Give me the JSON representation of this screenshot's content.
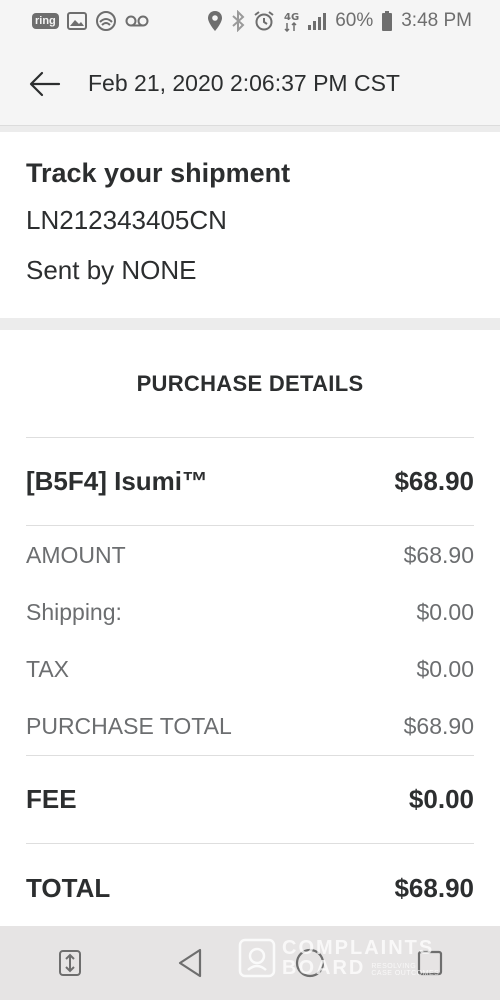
{
  "status_bar": {
    "ring_label": "ring",
    "battery": "60%",
    "time": "3:48 PM",
    "network_label": "4G",
    "icons": [
      "ring-icon",
      "image-icon",
      "allstate-icon",
      "voicemail-icon",
      "location-icon",
      "bluetooth-icon",
      "alarm-icon",
      "network-4g-icon",
      "signal-icon",
      "battery-icon"
    ]
  },
  "header": {
    "back_icon": "back-arrow-icon",
    "title": "Feb 21, 2020 2:06:37 PM CST"
  },
  "shipment": {
    "title": "Track your shipment",
    "tracking_number": "LN212343405CN",
    "sent_by": "Sent by NONE"
  },
  "purchase": {
    "title": "PURCHASE DETAILS",
    "item": {
      "name": "[B5F4]  Isumi™",
      "price": "$68.90"
    },
    "rows": [
      {
        "label": "AMOUNT",
        "value": "$68.90"
      },
      {
        "label": "Shipping:",
        "value": "$0.00"
      },
      {
        "label": "TAX",
        "value": "$0.00"
      },
      {
        "label": "PURCHASE TOTAL",
        "value": "$68.90"
      }
    ],
    "fee": {
      "label": "FEE",
      "value": "$0.00"
    },
    "total": {
      "label": "TOTAL",
      "value": "$68.90"
    }
  },
  "nav_bar": {
    "icons": [
      "dual-window-icon",
      "back-triangle-icon",
      "home-circle-icon",
      "recents-square-icon"
    ]
  },
  "watermark": {
    "line1": "COMPLAINTS",
    "line2": "BOARD",
    "tagline_1": "RESOLVING",
    "tagline_2": "CASE OUTCOMES"
  },
  "colors": {
    "text_primary": "#2c2e2f",
    "text_secondary": "#6c6e70",
    "header_bg": "#f5f5f5",
    "page_bg": "#ececec",
    "card_bg": "#ffffff"
  }
}
